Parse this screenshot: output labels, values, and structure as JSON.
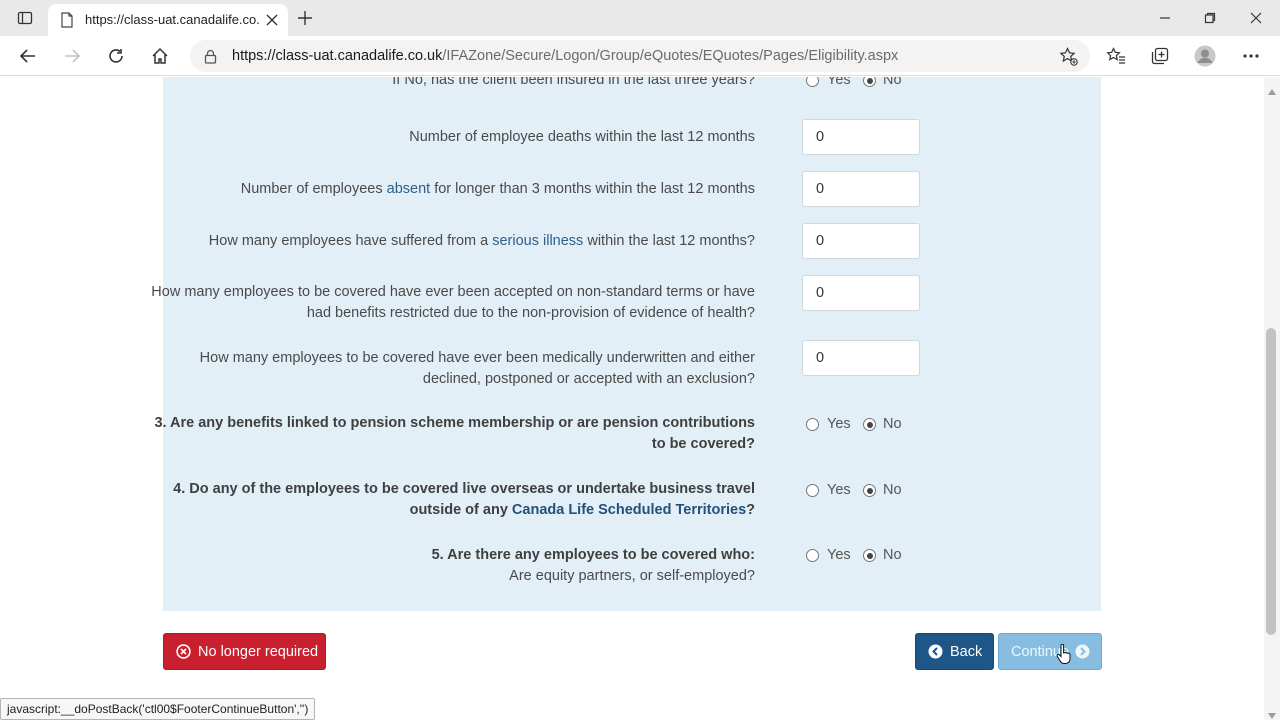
{
  "browser": {
    "tab_title": "https://class-uat.canadalife.co.uk",
    "url_host": "https://class-uat.canadalife.co.uk",
    "url_path": "/IFAZone/Secure/Logon/Group/eQuotes/EQuotes/Pages/Eligibility.aspx"
  },
  "form": {
    "q_insured_prev": "If No, has the client been insured in the last three years?",
    "q_deaths": "Number of employee deaths within the last 12 months",
    "q_absent_pre": "Number of employees ",
    "q_absent_link": "absent",
    "q_absent_post": " for longer than 3 months within the last 12 months",
    "q_illness_pre": "How many employees have suffered from a ",
    "q_illness_link": "serious illness",
    "q_illness_post": " within the last 12 months?",
    "q_nonstandard_1": "How many employees to be covered have ever been accepted on non-standard terms or have",
    "q_nonstandard_2": "had benefits restricted due to the non-provision of evidence of health?",
    "q_medical_1": "How many employees to be covered have ever been medically underwritten and either",
    "q_medical_2": "declined, postponed or accepted with an exclusion?",
    "q3_1": "3. Are any benefits linked to pension scheme membership or are pension contributions",
    "q3_2": "to be covered?",
    "q4_1": "4. Do any of the employees to be covered live overseas or undertake business travel",
    "q4_2_pre": "outside of any ",
    "q4_2_link": "Canada Life Scheduled Territories",
    "q4_2_post": "?",
    "q5_1": "5. Are there any employees to be covered who:",
    "q5_2": "Are equity partners, or self-employed?",
    "values": {
      "deaths": "0",
      "absent": "0",
      "illness": "0",
      "nonstandard": "0",
      "medical": "0"
    },
    "yes_label": "Yes",
    "no_label": "No"
  },
  "buttons": {
    "no_longer_required": "No longer required",
    "back": "Back",
    "continue": "Continue"
  },
  "status_bar": "javascript:__doPostBack('ctl00$FooterContinueButton','')"
}
